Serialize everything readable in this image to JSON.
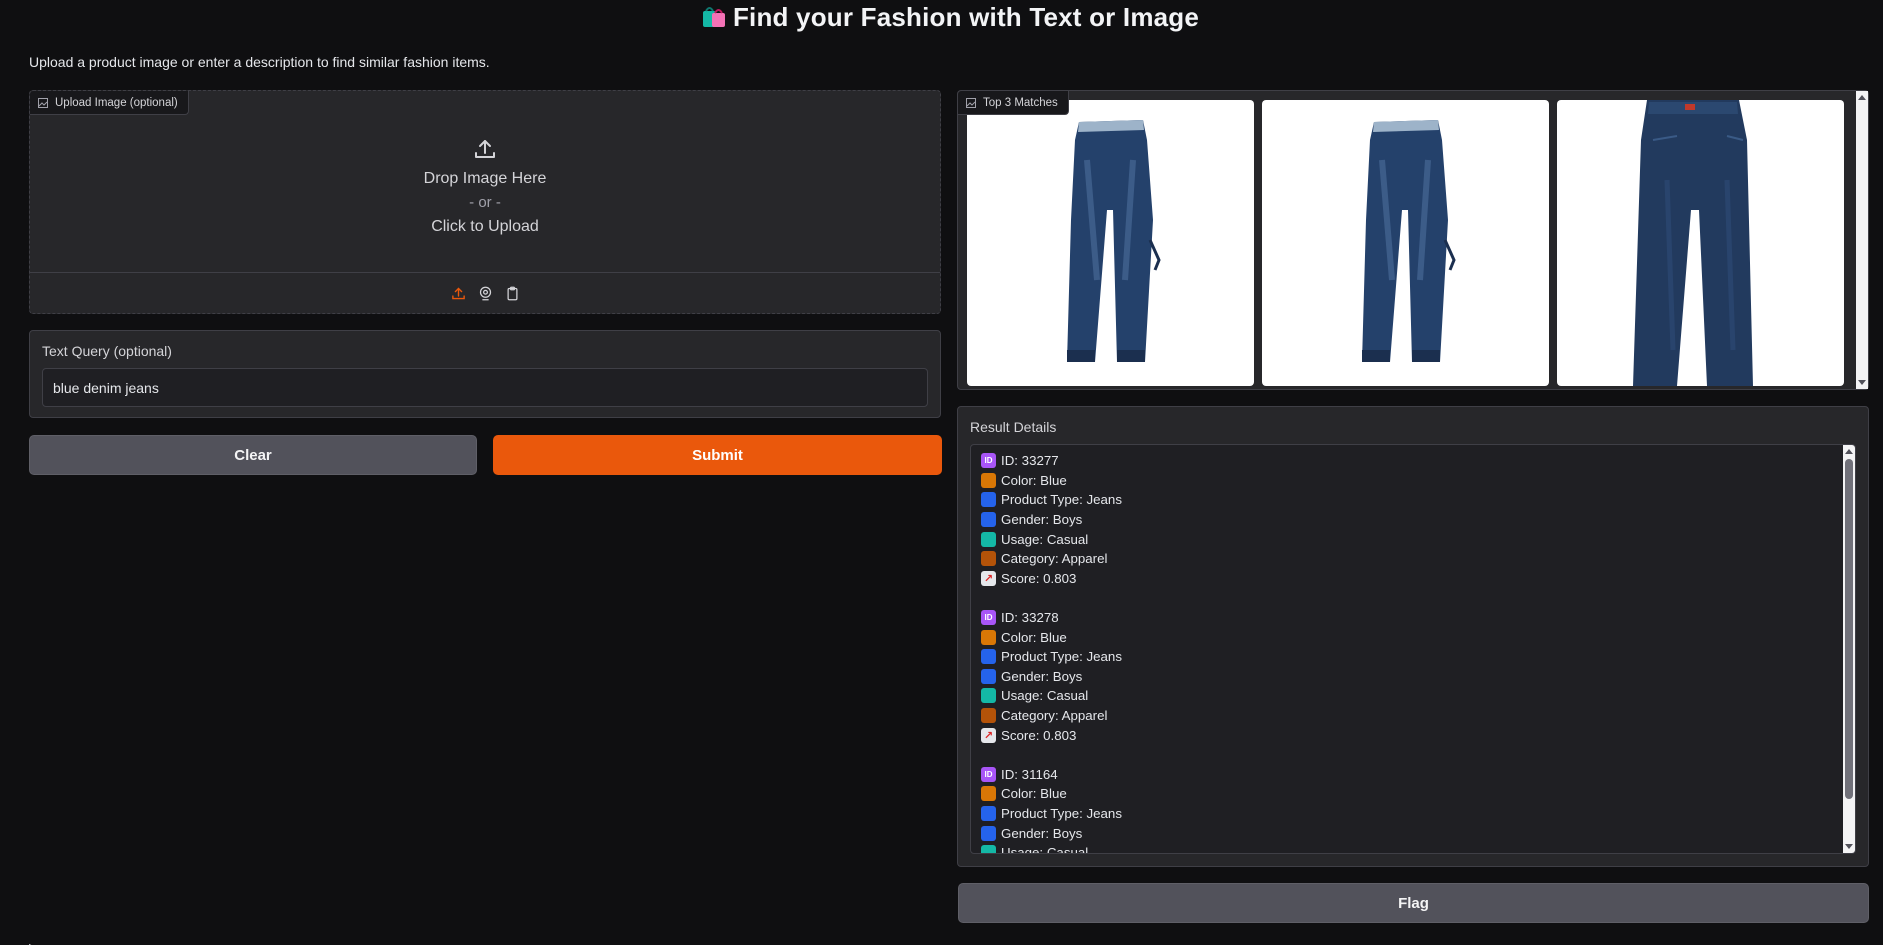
{
  "header": {
    "title": "Find your Fashion with Text or Image",
    "subtitle": "Upload a product image or enter a description to find similar fashion items."
  },
  "upload": {
    "label": "Upload Image (optional)",
    "drop_text": "Drop Image Here",
    "or_text": "- or -",
    "click_text": "Click to Upload",
    "tools": [
      "upload-icon",
      "webcam-icon",
      "clipboard-icon"
    ]
  },
  "text_query": {
    "label": "Text Query (optional)",
    "value": "blue denim jeans"
  },
  "buttons": {
    "clear": "Clear",
    "submit": "Submit",
    "flag": "Flag"
  },
  "gallery": {
    "label": "Top 3 Matches",
    "items": [
      "jeans-image-1",
      "jeans-image-2",
      "jeans-image-3"
    ]
  },
  "results": {
    "label": "Result Details",
    "entries": [
      {
        "id": "ID: 33277",
        "color": "Color: Blue",
        "type": "Product Type: Jeans",
        "gender": "Gender: Boys",
        "usage": "Usage: Casual",
        "category": "Category: Apparel",
        "score": "Score: 0.803"
      },
      {
        "id": "ID: 33278",
        "color": "Color: Blue",
        "type": "Product Type: Jeans",
        "gender": "Gender: Boys",
        "usage": "Usage: Casual",
        "category": "Category: Apparel",
        "score": "Score: 0.803"
      },
      {
        "id": "ID: 31164",
        "color": "Color: Blue",
        "type": "Product Type: Jeans",
        "gender": "Gender: Boys",
        "usage": "Usage: Casual"
      }
    ]
  },
  "colors": {
    "accent": "#ea580c",
    "background": "#0f0f11",
    "panel": "#27272a"
  }
}
